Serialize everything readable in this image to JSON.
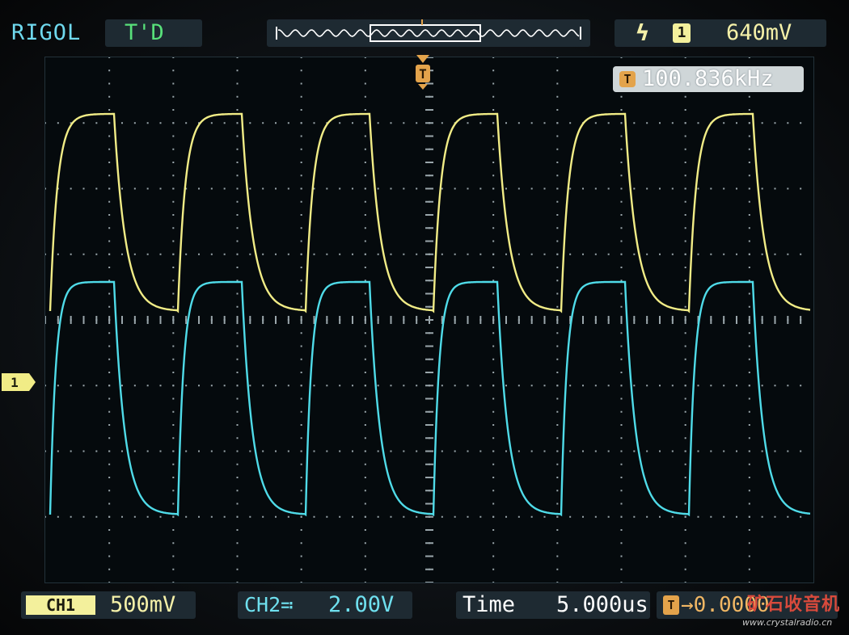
{
  "header": {
    "brand": "RIGOL",
    "status": "T'D",
    "trigger": {
      "slope_icon": "rising-edge-icon",
      "source": "1",
      "level": "640mV"
    }
  },
  "measurement": {
    "icon_letter": "T",
    "frequency": "100.836kHz"
  },
  "markers": {
    "trigger_position_letter": "T",
    "channel_marker_letter": "1"
  },
  "footer": {
    "ch1_tag": "CH1",
    "ch1_scale": "500mV",
    "ch2_tag": "CH2≕",
    "ch2_scale": "2.00V",
    "time_label": "Time",
    "time_scale": "5.000us",
    "delay_icon": "T",
    "delay_value": "→0.0000"
  },
  "watermark": {
    "text": "矿石收音机",
    "url": "www.crystalradio.cn"
  },
  "colors": {
    "ch1": "#f1ec86",
    "ch2": "#4fdbe8",
    "grid": "#9aa6ab",
    "trigger": "#e3a34b"
  }
}
